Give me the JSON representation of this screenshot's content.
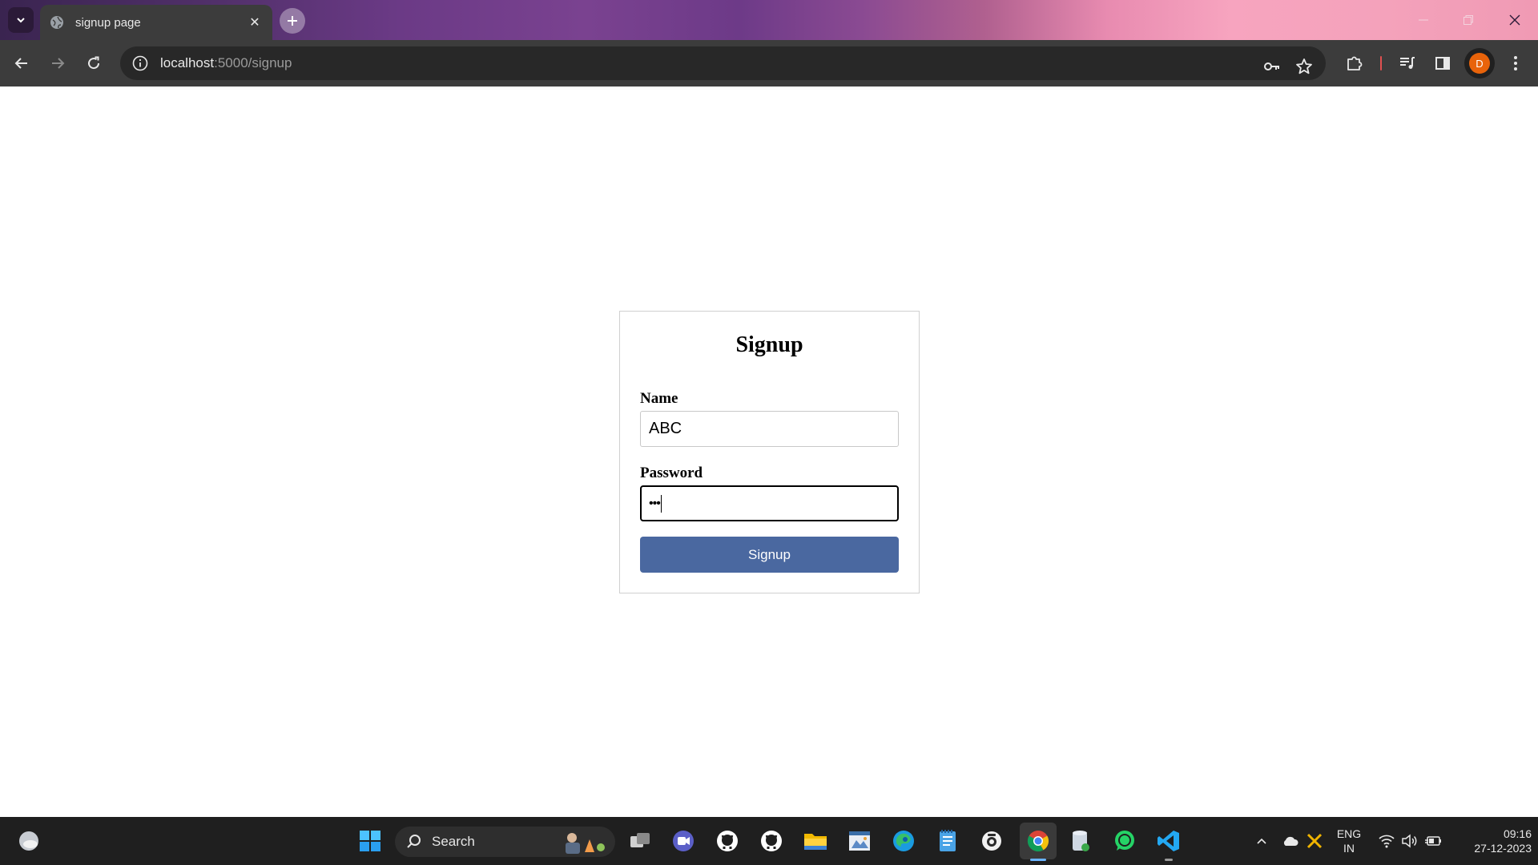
{
  "browser": {
    "tab_title": "signup page",
    "url_host": "localhost",
    "url_path": ":5000/signup",
    "profile_initial": "D"
  },
  "form": {
    "heading": "Signup",
    "name_label": "Name",
    "name_value": "ABC",
    "password_label": "Password",
    "password_value": "•••",
    "submit_label": "Signup"
  },
  "taskbar": {
    "search_label": "Search",
    "language_line1": "ENG",
    "language_line2": "IN",
    "time": "09:16",
    "date": "27-12-2023"
  },
  "colors": {
    "submit_button": "#4a68a0",
    "profile_avatar": "#e8630a"
  }
}
